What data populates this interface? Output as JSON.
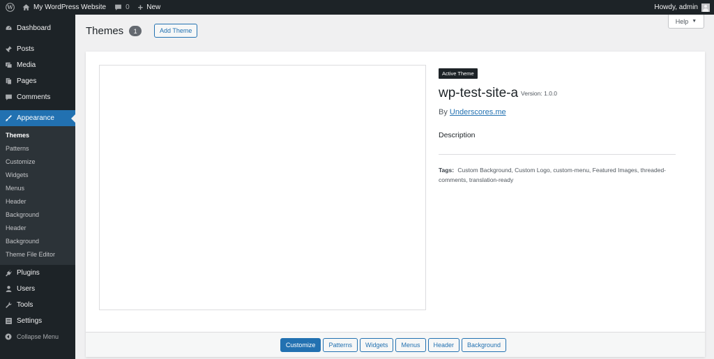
{
  "adminbar": {
    "site_name": "My WordPress Website",
    "comments_count": "0",
    "new_label": "New",
    "greeting": "Howdy, admin"
  },
  "sidebar": {
    "items": [
      {
        "label": "Dashboard",
        "icon": "dashboard-icon"
      },
      {
        "label": "Posts",
        "icon": "pin-icon"
      },
      {
        "label": "Media",
        "icon": "media-icon"
      },
      {
        "label": "Pages",
        "icon": "pages-icon"
      },
      {
        "label": "Comments",
        "icon": "comment-icon"
      },
      {
        "label": "Appearance",
        "icon": "brush-icon"
      }
    ],
    "submenu": [
      "Themes",
      "Patterns",
      "Customize",
      "Widgets",
      "Menus",
      "Header",
      "Background",
      "Header",
      "Background",
      "Theme File Editor"
    ],
    "lower_items": [
      {
        "label": "Plugins",
        "icon": "plug-icon"
      },
      {
        "label": "Users",
        "icon": "user-icon"
      },
      {
        "label": "Tools",
        "icon": "wrench-icon"
      },
      {
        "label": "Settings",
        "icon": "settings-icon"
      }
    ],
    "collapse_label": "Collapse Menu"
  },
  "header": {
    "title": "Themes",
    "count": "1",
    "add_theme_label": "Add Theme",
    "help_label": "Help"
  },
  "theme": {
    "badge": "Active Theme",
    "name": "wp-test-site-a",
    "version": "Version: 1.0.0",
    "author_prefix": "By",
    "author": "Underscores.me",
    "description": "Description",
    "tags_label": "Tags:",
    "tags": "Custom Background, Custom Logo, custom-menu, Featured Images, threaded-comments, translation-ready"
  },
  "actions": [
    "Customize",
    "Patterns",
    "Widgets",
    "Menus",
    "Header",
    "Background"
  ],
  "colors": {
    "admin_bar": "#1d2327",
    "accent": "#2271b1",
    "submenu_bg": "#2c3338",
    "page_bg": "#f0f0f1"
  }
}
